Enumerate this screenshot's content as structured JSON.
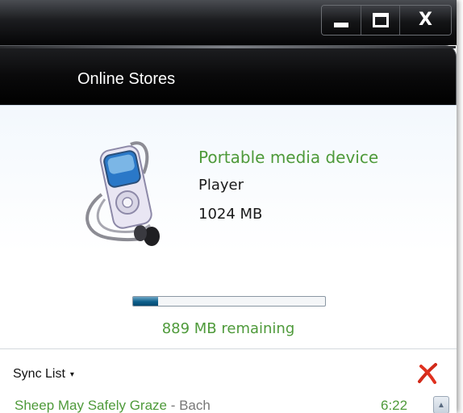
{
  "window": {
    "caption": {
      "minimize_icon": "minimize-icon",
      "maximize_icon": "maximize-icon",
      "close_label": "X"
    }
  },
  "tabs": {
    "active": "Online Stores"
  },
  "device": {
    "icon": "portable-media-player-icon",
    "name": "Portable media device",
    "model": "Player",
    "capacity": "1024 MB",
    "storage_used_fraction": 0.13,
    "remaining": "889 MB remaining"
  },
  "sync": {
    "header": "Sync List",
    "caret": "▾",
    "delete_icon": "red-x-delete-icon",
    "tracks": [
      {
        "title": "Sheep May Safely Graze",
        "separator": " - ",
        "artist": "Bach",
        "duration": "6:22"
      }
    ]
  },
  "colors": {
    "accent_green": "#4e9a3a",
    "progress_fill": "#0d5f8c",
    "titlebar": "#050506"
  }
}
